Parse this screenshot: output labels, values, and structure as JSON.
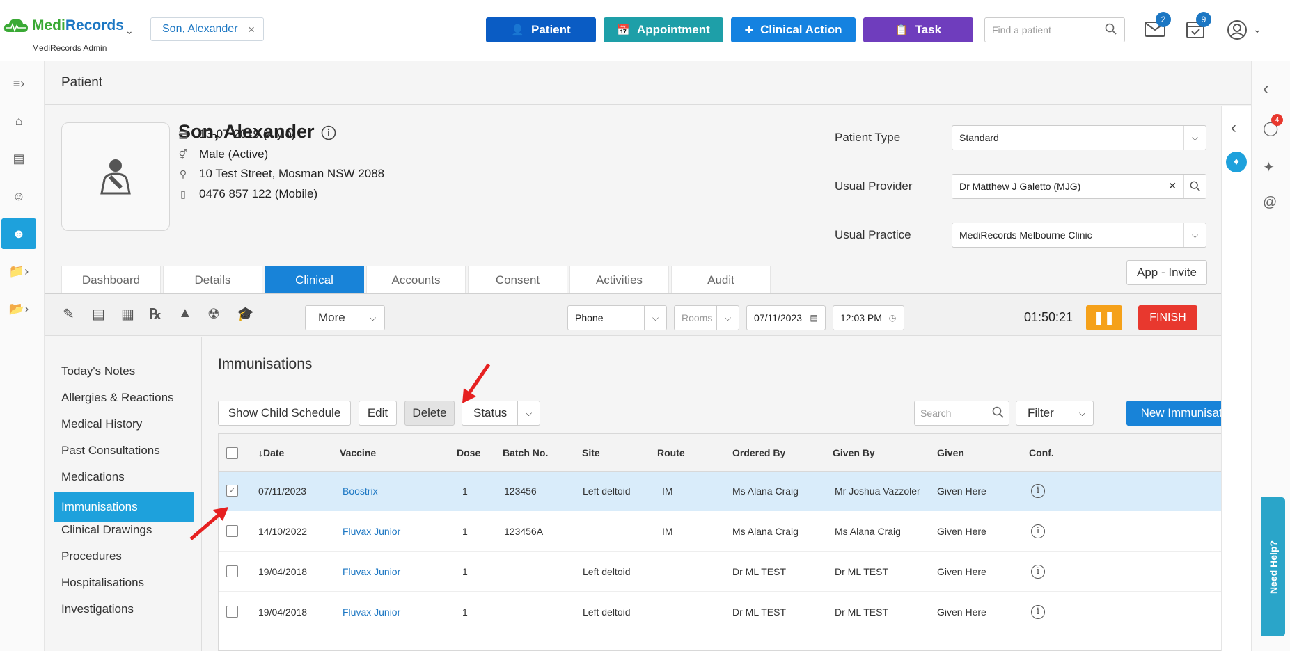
{
  "header": {
    "logo_text_medi": "Medi",
    "logo_text_records": "Records",
    "logo_subtitle": "MediRecords Admin",
    "patient_chip": "Son, Alexander",
    "btn_patient": "Patient",
    "btn_appointment": "Appointment",
    "btn_clinical_action": "Clinical Action",
    "btn_task": "Task",
    "search_placeholder": "Find a patient",
    "mail_count": "2",
    "tasks_count": "9",
    "colors": {
      "patient": "#0a5cc4",
      "appointment": "#1e9fa8",
      "clinical_action": "#1482e0",
      "task": "#6f3dbd"
    }
  },
  "page": {
    "title": "Patient"
  },
  "patient": {
    "name": "Son, Alexander",
    "dob": "13-07-2019 (4 y.o)",
    "gender": "Male (Active)",
    "address": "10 Test Street, Mosman NSW 2088",
    "phone": "0476 857 122 (Mobile)",
    "patient_type_label": "Patient Type",
    "patient_type_value": "Standard",
    "usual_provider_label": "Usual Provider",
    "usual_provider_value": "Dr Matthew J Galetto (MJG)",
    "usual_practice_label": "Usual Practice",
    "usual_practice_value": "MediRecords Melbourne Clinic",
    "app_invite": "App - Invite"
  },
  "tabs": [
    "Dashboard",
    "Details",
    "Clinical",
    "Accounts",
    "Consent",
    "Activities",
    "Audit"
  ],
  "toolbar": {
    "more": "More",
    "contact_type": "Phone",
    "rooms_placeholder": "Rooms",
    "date": "07/11/2023",
    "time": "12:03 PM",
    "timer": "01:50:21",
    "finish": "FINISH"
  },
  "sidemenu": [
    "Today's Notes",
    "Allergies & Reactions",
    "Medical History",
    "Past Consultations",
    "Medications",
    "Immunisations",
    "Clinical Drawings",
    "Procedures",
    "Hospitalisations",
    "Investigations"
  ],
  "immunisations": {
    "title": "Immunisations",
    "btn_child_schedule": "Show Child Schedule",
    "btn_edit": "Edit",
    "btn_delete": "Delete",
    "btn_status": "Status",
    "search_placeholder": "Search",
    "btn_filter": "Filter",
    "btn_new": "New Immunisation",
    "columns": [
      "↓Date",
      "Vaccine",
      "Dose",
      "Batch No.",
      "Site",
      "Route",
      "Ordered By",
      "Given By",
      "Given",
      "Conf."
    ],
    "rows": [
      {
        "date": "07/11/2023",
        "vaccine": "Boostrix",
        "dose": "1",
        "batch": "123456",
        "site": "Left deltoid",
        "route": "IM",
        "ordered_by": "Ms Alana Craig",
        "given_by": "Mr Joshua Vazzoler",
        "given": "Given Here",
        "checked": true
      },
      {
        "date": "14/10/2022",
        "vaccine": "Fluvax Junior",
        "dose": "1",
        "batch": "123456A",
        "site": "",
        "route": "IM",
        "ordered_by": "Ms Alana Craig",
        "given_by": "Ms Alana Craig",
        "given": "Given Here",
        "checked": false
      },
      {
        "date": "19/04/2018",
        "vaccine": "Fluvax Junior",
        "dose": "1",
        "batch": "",
        "site": "Left deltoid",
        "route": "",
        "ordered_by": "Dr ML TEST",
        "given_by": "Dr ML TEST",
        "given": "Given Here",
        "checked": false
      },
      {
        "date": "19/04/2018",
        "vaccine": "Fluvax Junior",
        "dose": "1",
        "batch": "",
        "site": "Left deltoid",
        "route": "",
        "ordered_by": "Dr ML TEST",
        "given_by": "Dr ML TEST",
        "given": "Given Here",
        "checked": false
      }
    ]
  },
  "right_rail": {
    "chat_count": "4",
    "need_help": "Need Help?"
  }
}
